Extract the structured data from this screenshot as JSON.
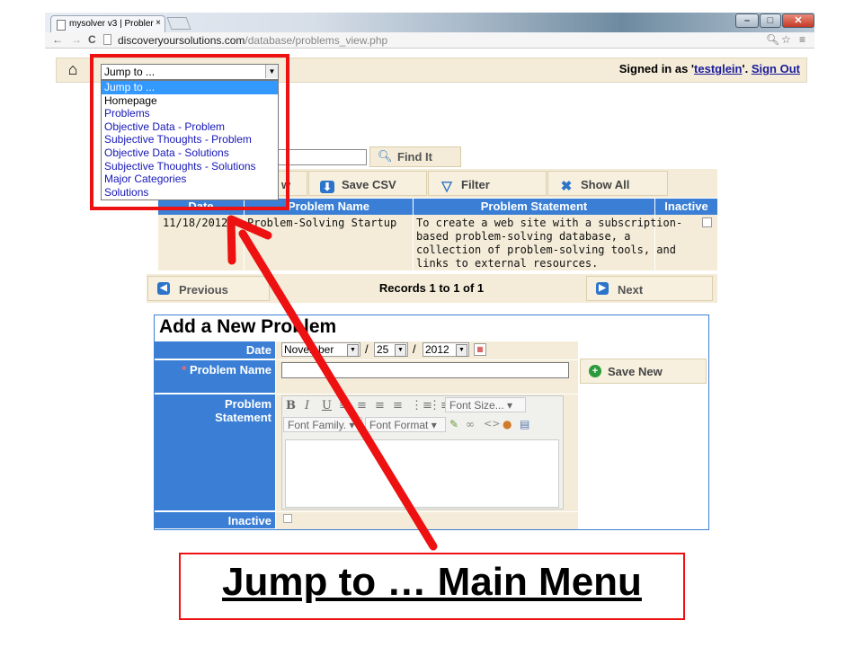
{
  "browser": {
    "tab_title": "mysolver v3 | Probler",
    "tab_close": "×",
    "url_domain": "discoveryoursolutions.com",
    "url_path": "/database/problems_view.php"
  },
  "header": {
    "signed_in_prefix": "Signed in as '",
    "username": "testglein",
    "signed_in_suffix": "'. ",
    "sign_out": "Sign Out"
  },
  "jump": {
    "selected": "Jump to ...",
    "options": [
      "Jump to ...",
      "Homepage",
      "Problems",
      "Objective Data - Problem",
      "Subjective Thoughts - Problem",
      "Objective Data - Solutions",
      "Subjective Thoughts - Solutions",
      "Major Categories",
      "Solutions"
    ]
  },
  "search": {
    "find_label": "Find It"
  },
  "toolbar": {
    "new_label": "w",
    "save_csv": "Save CSV",
    "filter": "Filter",
    "show_all": "Show All"
  },
  "table": {
    "headers": [
      "Date",
      "Problem Name",
      "Problem Statement",
      "Inactive"
    ],
    "rows": [
      {
        "date": "11/18/2012",
        "name": "Problem-Solving Startup",
        "statement_lines": [
          "To create a web site with a subscription-",
          "based problem-solving database, a",
          "collection of problem-solving tools, and",
          "links to external resources."
        ]
      }
    ]
  },
  "pager": {
    "previous": "Previous",
    "records": "Records 1 to 1 of 1",
    "next": "Next"
  },
  "form": {
    "title": "Add a New Problem",
    "date_label": "Date",
    "month": "November",
    "day": "25",
    "year": "2012",
    "required_mark": "*",
    "name_label": "Problem Name",
    "statement_label_1": "Problem",
    "statement_label_2": "Statement",
    "inactive_label": "Inactive",
    "save_new": "Save New",
    "editor": {
      "font_size": "Font Size...",
      "font_family": "Font Family.",
      "font_format": "Font Format"
    }
  },
  "annotation": {
    "caption": "Jump to … Main Menu",
    "color": "#ee1111"
  },
  "colors": {
    "accent_blue": "#3a7fd5",
    "panel_tan": "#f4ecd8",
    "selected_option": "#3399ff"
  }
}
